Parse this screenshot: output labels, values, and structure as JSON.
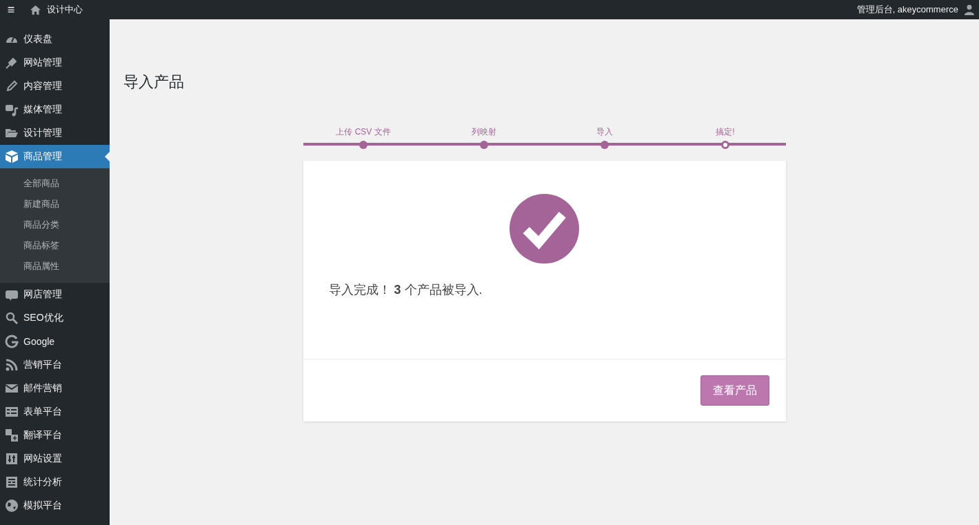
{
  "top_bar": {
    "menu_glyph": "≡",
    "site_title": "设计中心",
    "account": "管理后台, akeycommerce"
  },
  "sidebar": {
    "items": [
      {
        "label": "仪表盘",
        "selected": false
      },
      {
        "label": "网站管理",
        "selected": false
      },
      {
        "label": "内容管理",
        "selected": false
      },
      {
        "label": "媒体管理",
        "selected": false
      },
      {
        "label": "设计管理",
        "selected": false
      },
      {
        "label": "商品管理",
        "selected": true,
        "children": [
          {
            "label": "全部商品",
            "selected": false
          },
          {
            "label": "新建商品",
            "selected": false
          },
          {
            "label": "商品分类",
            "selected": false
          },
          {
            "label": "商品标签",
            "selected": false
          },
          {
            "label": "商品属性",
            "selected": false
          }
        ]
      },
      {
        "label": "网店管理",
        "selected": false
      },
      {
        "label": "SEO优化",
        "selected": false
      },
      {
        "label": "Google",
        "selected": false
      },
      {
        "label": "营销平台",
        "selected": false
      },
      {
        "label": "邮件营销",
        "selected": false
      },
      {
        "label": "表单平台",
        "selected": false
      },
      {
        "label": "翻译平台",
        "selected": false
      },
      {
        "label": "网站设置",
        "selected": false
      },
      {
        "label": "统计分析",
        "selected": false
      },
      {
        "label": "模拟平台",
        "selected": false
      }
    ]
  },
  "page": {
    "title": "导入产品",
    "steps": [
      {
        "label": "上传 CSV 文件",
        "selected": false
      },
      {
        "label": "列映射",
        "selected": false
      },
      {
        "label": "导入",
        "selected": false
      },
      {
        "label": "搞定!",
        "selected": true
      }
    ],
    "message": "导入完成！ **3** 个产品被导入.",
    "button": "查看产品"
  }
}
